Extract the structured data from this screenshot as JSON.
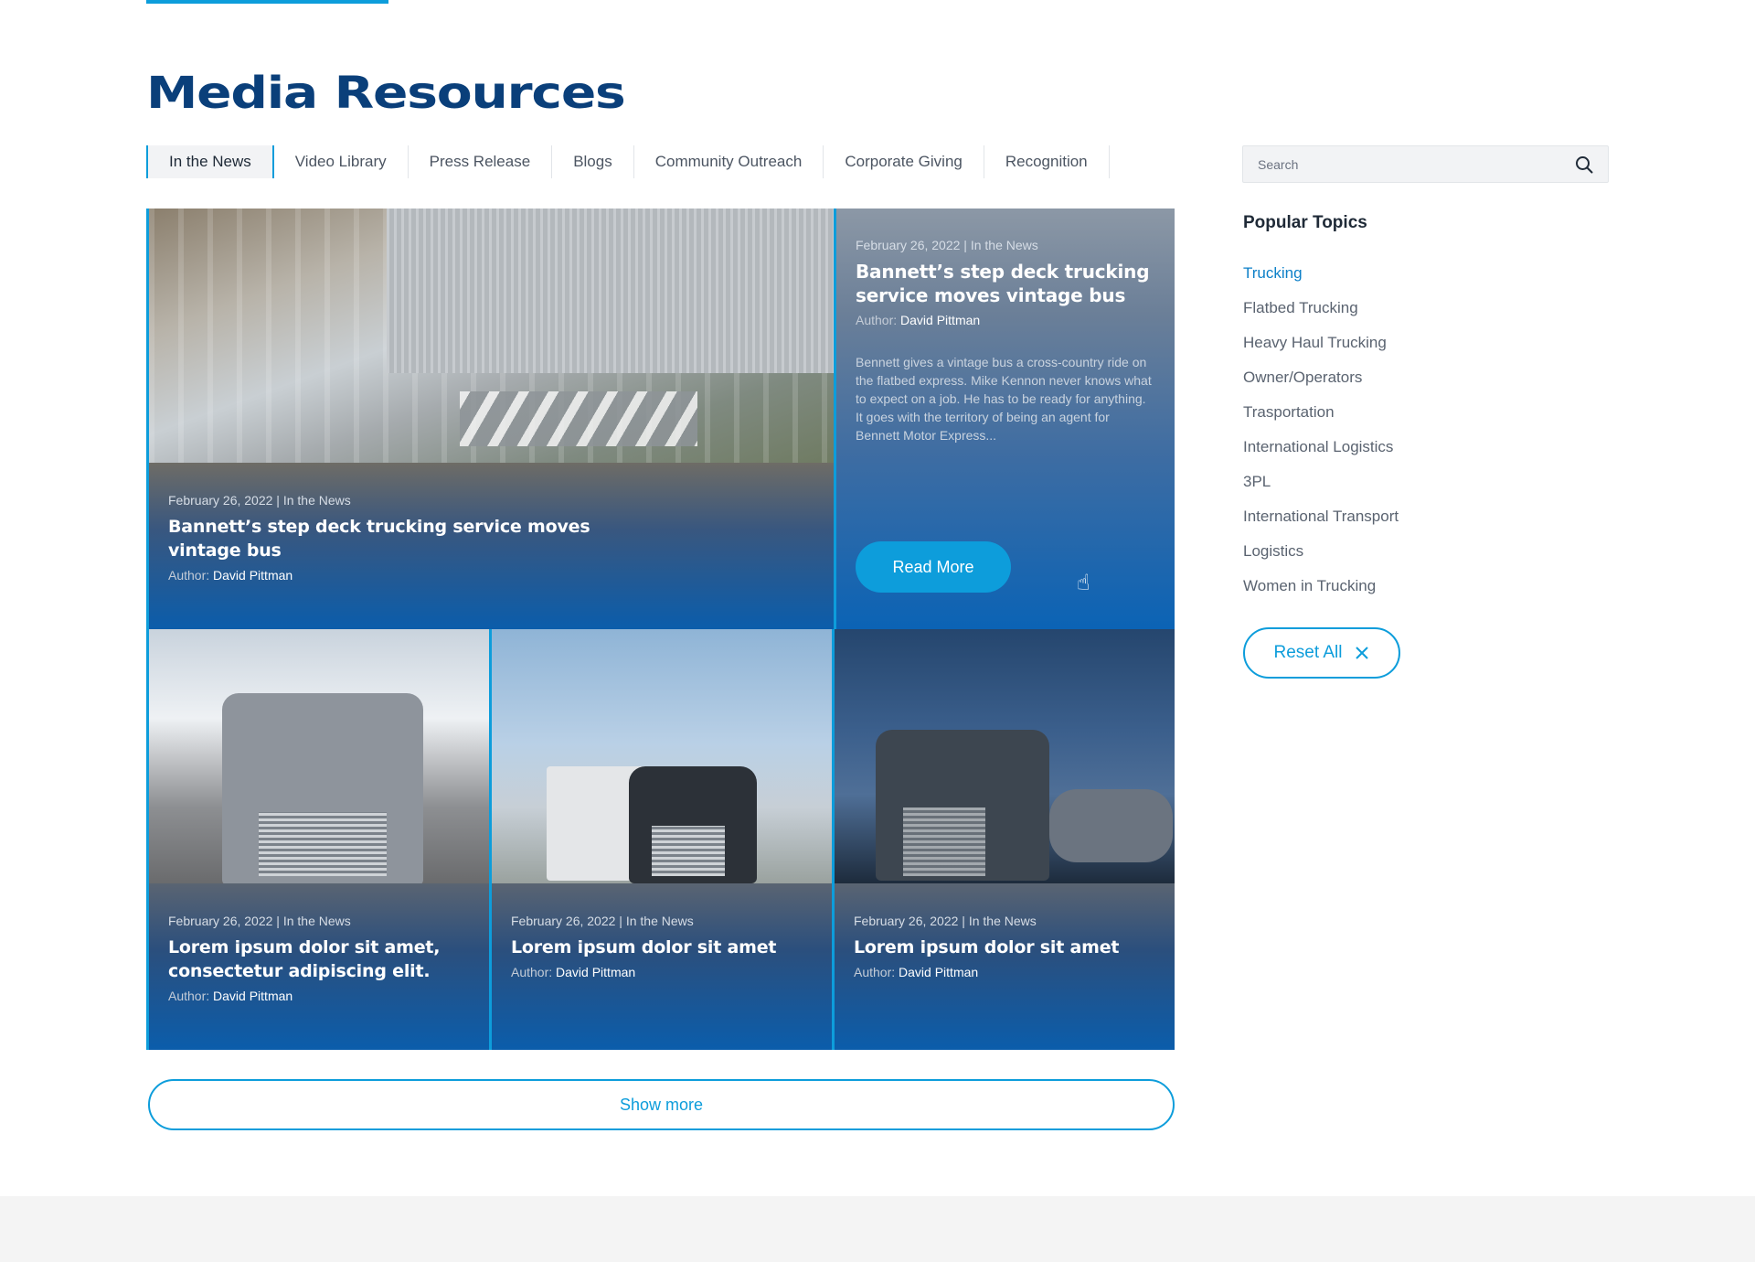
{
  "page": {
    "title": "Media Resources"
  },
  "tabs": [
    {
      "label": "In the News"
    },
    {
      "label": "Video Library"
    },
    {
      "label": "Press Release"
    },
    {
      "label": "Blogs"
    },
    {
      "label": "Community Outreach"
    },
    {
      "label": "Corporate Giving"
    },
    {
      "label": "Recognition"
    }
  ],
  "hero": {
    "meta": "February 26, 2022 | In the News",
    "title": "Bannett’s step deck trucking service moves vintage bus",
    "author_label": "Author: ",
    "author_name": "David Pittman"
  },
  "feature": {
    "meta": "February 26, 2022 | In the News",
    "title": "Bannett’s step deck trucking service moves vintage bus",
    "author_label": "Author: ",
    "author_name": "David Pittman",
    "excerpt": "Bennett gives a vintage bus a cross-country ride on the flatbed express. Mike Kennon never knows what to expect on a job. He has to be ready for anything. It goes with the territory of being an agent for Bennett Motor Express...",
    "button": "Read More"
  },
  "cards": [
    {
      "meta": "February 26, 2022 | In the News",
      "title": "Lorem ipsum dolor sit amet, consectetur adipiscing elit.",
      "author_label": "Author: ",
      "author_name": "David Pittman"
    },
    {
      "meta": "February 26, 2022 | In the News",
      "title": "Lorem ipsum dolor sit amet",
      "author_label": "Author: ",
      "author_name": "David Pittman"
    },
    {
      "meta": "February 26, 2022 | In the News",
      "title": "Lorem ipsum dolor sit amet",
      "author_label": "Author: ",
      "author_name": "David Pittman"
    }
  ],
  "show_more": "Show more",
  "sidebar": {
    "search_placeholder": "Search",
    "popular_title": "Popular Topics",
    "topics": [
      {
        "label": "Trucking",
        "active": true
      },
      {
        "label": "Flatbed Trucking"
      },
      {
        "label": "Heavy Haul Trucking"
      },
      {
        "label": "Owner/Operators"
      },
      {
        "label": "Trasportation"
      },
      {
        "label": "International Logistics"
      },
      {
        "label": "3PL"
      },
      {
        "label": "International Transport"
      },
      {
        "label": "Logistics"
      },
      {
        "label": "Women in Trucking"
      }
    ],
    "reset_label": "Reset All"
  },
  "colors": {
    "brand_navy": "#0a3f7a",
    "accent": "#0d9ddb",
    "card_blue": "#0b5dab"
  }
}
